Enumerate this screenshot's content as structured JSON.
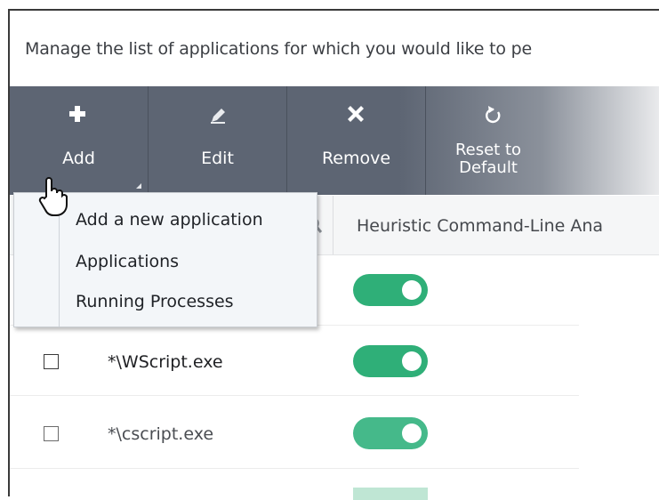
{
  "description": "Manage the list of applications for which you would like to pe",
  "toolbar": {
    "add_label": "Add",
    "edit_label": "Edit",
    "remove_label": "Remove",
    "reset_label_line1": "Reset to",
    "reset_label_line2": "Default"
  },
  "table": {
    "column_header": "Heuristic Command-Line Ana"
  },
  "add_menu": {
    "items": [
      "Add a new application",
      "Applications",
      "Running Processes"
    ]
  },
  "rows": [
    {
      "name": "",
      "enabled": true
    },
    {
      "name": "*\\WScript.exe",
      "enabled": true
    },
    {
      "name": "*\\cscript.exe",
      "enabled": true
    }
  ],
  "colors": {
    "toggle_on": "#2faf78",
    "toolbar": "#5d6573"
  }
}
